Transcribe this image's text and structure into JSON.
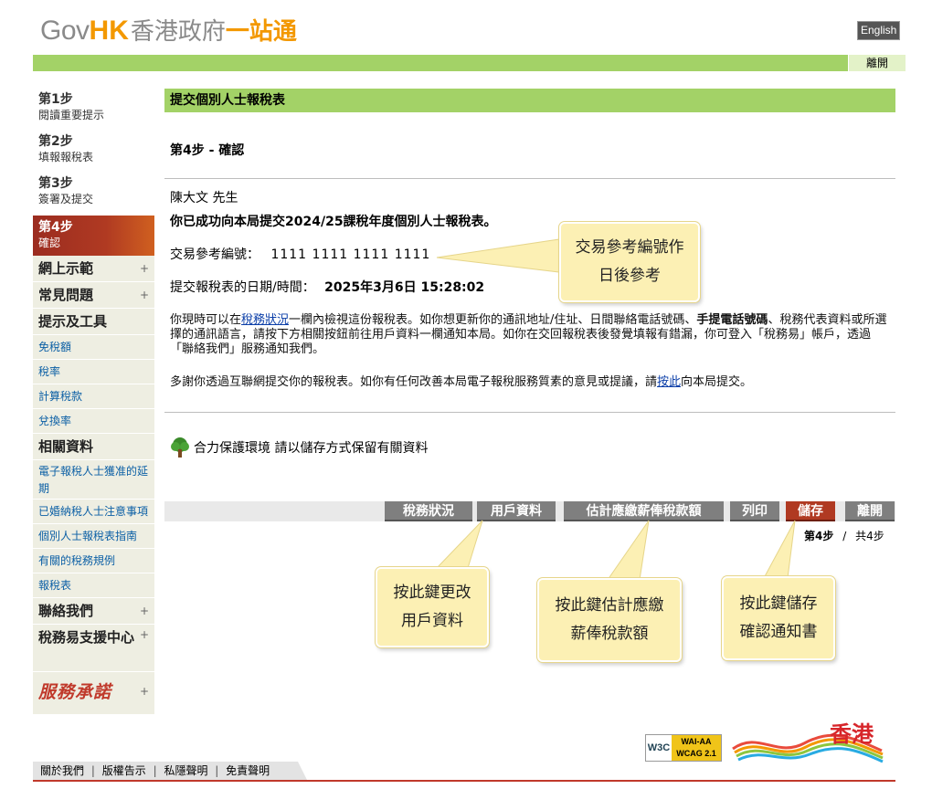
{
  "header": {
    "logo": {
      "gov": "Gov",
      "hk": "HK",
      "cn_part1": "香港政府",
      "cn_part2": "一站通"
    },
    "english_label": "English",
    "logout_label": "離開"
  },
  "sidebar": {
    "steps": [
      {
        "title": "第1步",
        "sub": "閱讀重要提示"
      },
      {
        "title": "第2步",
        "sub": "填報報稅表"
      },
      {
        "title": "第3步",
        "sub": "簽署及提交"
      },
      {
        "title": "第4步",
        "sub": "確認"
      }
    ],
    "nav": [
      {
        "label": "網上示範",
        "kind": "big",
        "plus": "+"
      },
      {
        "label": "常見問題",
        "kind": "big",
        "plus": "+"
      },
      {
        "label": "提示及工具",
        "kind": "big",
        "plus": ""
      },
      {
        "label": "免稅額",
        "kind": "small"
      },
      {
        "label": "稅率",
        "kind": "small"
      },
      {
        "label": "計算稅款",
        "kind": "small"
      },
      {
        "label": "兌換率",
        "kind": "small"
      },
      {
        "label": "相關資料",
        "kind": "big",
        "plus": ""
      },
      {
        "label": "電子報稅人士獲准的延期",
        "kind": "two"
      },
      {
        "label": "已婚納稅人士注意事項",
        "kind": "small"
      },
      {
        "label": "個別人士報稅表指南",
        "kind": "small"
      },
      {
        "label": "有關的稅務規例",
        "kind": "small"
      },
      {
        "label": "報稅表",
        "kind": "small"
      },
      {
        "label": "聯絡我們",
        "kind": "big",
        "plus": "+"
      },
      {
        "label": "稅務易支援中心",
        "kind": "big2",
        "plus": "+"
      }
    ],
    "pledge_label": "服務承諾",
    "pledge_plus": "+"
  },
  "main": {
    "heading": "提交個別人士報稅表",
    "step_title": "第4步 - 確認",
    "name": "陳大文 先生",
    "success": "你已成功向本局提交2024/25課稅年度個別人士報稅表。",
    "ref_label": "交易參考編號：",
    "ref_value": "1111 1111 1111 1111",
    "date_label": "提交報稅表的日期/時間：",
    "date_value": "2025年3月6日 15:28:02",
    "para1_a": "你現時可以在",
    "para1_link": "稅務狀況",
    "para1_b": "一欄內檢視這份報稅表。如你想更新你的通訊地址/住址、日間聯絡電話號碼、",
    "para1_bold": "手提電話號碼",
    "para1_c": "、稅務代表資料或所選擇的通訊語言，請按下方相關按鈕前往用戶資料一欄通知本局。如你在交回報稅表後發覺填報有錯漏，你可登入「稅務易」帳戶，透過「聯絡我們」服務通知我們。",
    "para2_a": "多謝你透過互聯網提交你的報稅表。如你有任何改善本局電子報稅服務質素的意見或提議，請",
    "para2_link": "按此",
    "para2_b": "向本局提交。",
    "green_note": "合力保護環境 請以儲存方式保留有關資料"
  },
  "buttons": {
    "tax_status": "稅務狀況",
    "user_info": "用戶資料",
    "estimate": "估計應繳薪俸稅款額",
    "print": "列印",
    "save": "儲存",
    "exit": "離開"
  },
  "pager": {
    "current": "第4步",
    "sep": "/",
    "total": "共4步"
  },
  "callouts": {
    "ref": [
      "交易參考編號作",
      "日後參考"
    ],
    "user": [
      "按此鍵更改",
      "用戶資料"
    ],
    "estimate": [
      "按此鍵估計應繳",
      "薪俸稅款額"
    ],
    "save": [
      "按此鍵儲存",
      "確認通知書"
    ]
  },
  "footer": {
    "links": [
      "關於我們",
      "版權告示",
      "私隱聲明",
      "免責聲明"
    ],
    "wcag_w3c": "W3C",
    "wcag_line1": "WAI-AA",
    "wcag_line2": "WCAG 2.1",
    "brand": "香港"
  },
  "colors": {
    "green": "#a3d267",
    "orange": "#f39800",
    "active_red": "#b03a22",
    "button_grey": "#7f7f7f",
    "callout": "#fcf0b4"
  }
}
